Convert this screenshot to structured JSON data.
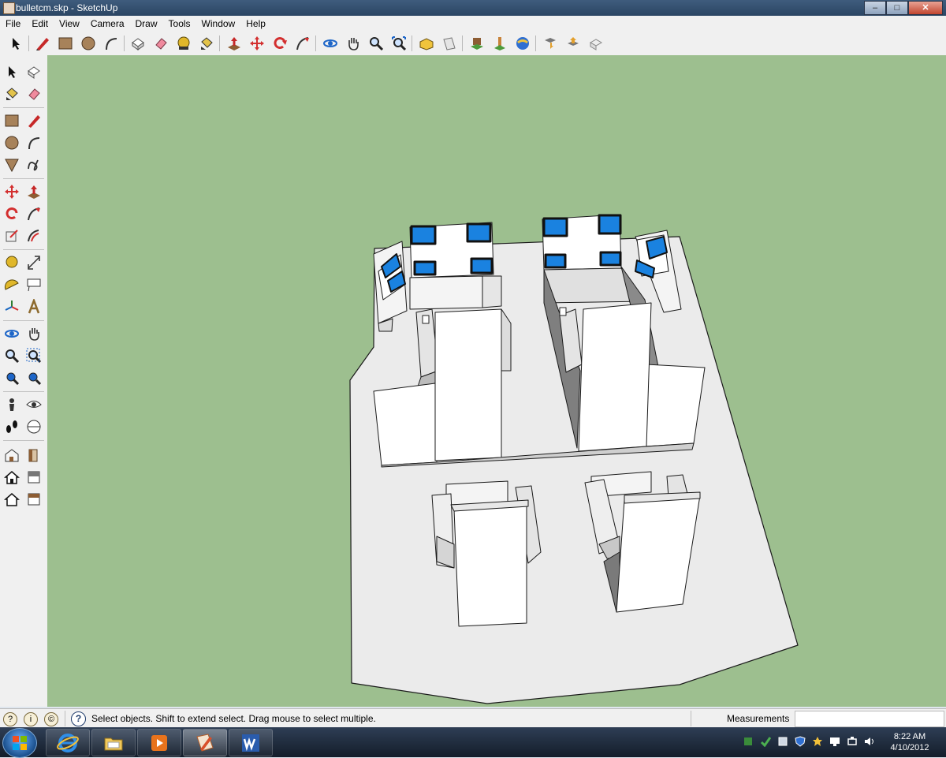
{
  "window": {
    "title": "bulletcm.skp - SketchUp"
  },
  "window_controls": {
    "minimize": "–",
    "maximize": "□",
    "close": "✕"
  },
  "menu": [
    "File",
    "Edit",
    "View",
    "Camera",
    "Draw",
    "Tools",
    "Window",
    "Help"
  ],
  "main_toolbar": [
    "select-icon",
    "pencil-icon",
    "rectangle-icon",
    "circle-icon",
    "arc-icon",
    "make-component-icon",
    "eraser-icon",
    "tape-measure-icon",
    "paint-bucket-icon",
    "push-pull-icon",
    "move-icon",
    "rotate-icon",
    "follow-me-icon",
    "orbit-icon",
    "pan-icon",
    "zoom-icon",
    "zoom-extents-icon",
    "3d-warehouse-icon",
    "share-model-icon",
    "place-model-icon",
    "preview-in-earth-icon",
    "get-current-view-icon",
    "get-models-icon",
    "share-component-icon",
    "toggle-terrain-icon"
  ],
  "left_toolbar": [
    "select-icon",
    "make-component-icon",
    "paint-bucket-icon",
    "eraser-icon",
    "rectangle-icon",
    "pencil-icon",
    "circle-icon",
    "arc-icon",
    "polygon-icon",
    "freehand-icon",
    "move-icon",
    "push-pull-icon",
    "rotate-icon",
    "follow-me-icon",
    "scale-icon",
    "offset-icon",
    "tape-measure-icon",
    "dimension-icon",
    "protractor-icon",
    "text-icon",
    "axes-icon",
    "3d-text-icon",
    "orbit-icon",
    "pan-icon",
    "zoom-icon",
    "zoom-window-icon",
    "previous-view-icon",
    "zoom-extents-icon",
    "position-camera-icon",
    "look-around-icon",
    "walk-icon",
    "section-plane-icon",
    "3d-warehouse-icon",
    "get-models-icon",
    "house-icon",
    "share-model-icon",
    "house-outline-icon",
    "component-icon"
  ],
  "colors": {
    "viewport": "#9dbf8f",
    "screen_blue": "#1a82e0",
    "titlebar": "#2b4563"
  },
  "status": {
    "message": "Select objects. Shift to extend select. Drag mouse to select multiple.",
    "measurements_label": "Measurements",
    "measurements_value": ""
  },
  "taskbar": {
    "apps": [
      "internet-explorer-icon",
      "windows-explorer-icon",
      "media-player-icon",
      "sketchup-icon",
      "word-icon"
    ],
    "tray": [
      "network-icon",
      "update-icon",
      "security-icon",
      "shield-icon",
      "star-icon",
      "display-icon",
      "power-icon",
      "volume-icon"
    ],
    "time": "8:22 AM",
    "date": "4/10/2012"
  }
}
